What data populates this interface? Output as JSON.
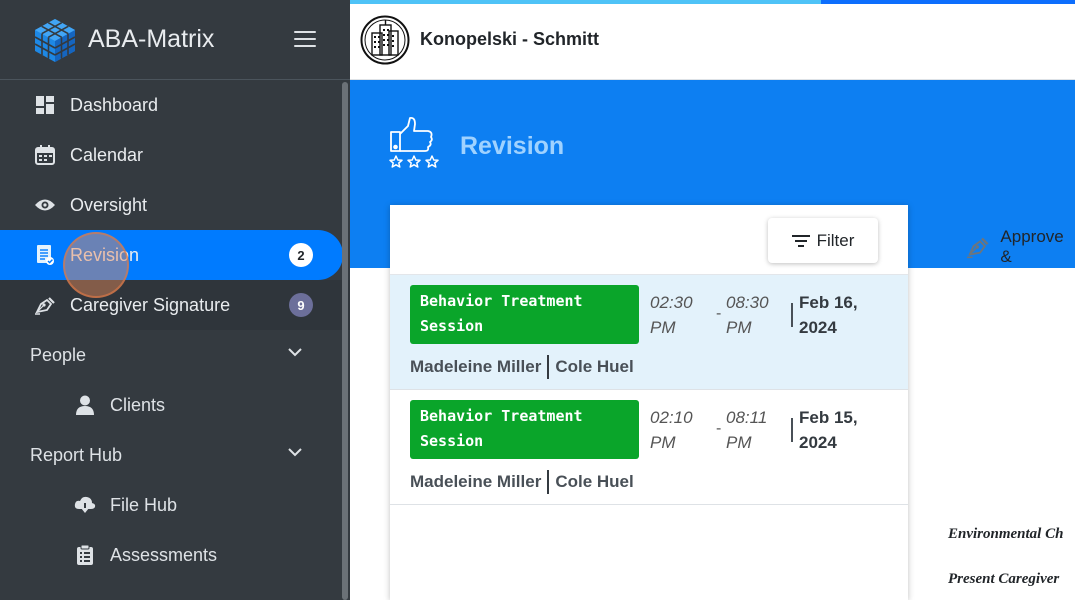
{
  "app": {
    "name": "ABA-Matrix"
  },
  "company": {
    "name": "Konopelski - Schmitt"
  },
  "nav": {
    "dashboard": "Dashboard",
    "calendar": "Calendar",
    "oversight": "Oversight",
    "revision": "Revision",
    "revision_badge": "2",
    "caregiver_signature": "Caregiver Signature",
    "caregiver_badge": "9",
    "people": "People",
    "clients": "Clients",
    "report_hub": "Report Hub",
    "file_hub": "File Hub",
    "assessments": "Assessments"
  },
  "page": {
    "title": "Revision"
  },
  "list": {
    "filter_label": "Filter",
    "sessions": [
      {
        "type": "Behavior Treatment Session",
        "start": "02:30 PM",
        "end": "08:30 PM",
        "separator": "-",
        "date": "Feb 16, 2024",
        "client": "Madeleine Miller",
        "provider": "Cole Huel"
      },
      {
        "type": "Behavior Treatment Session",
        "start": "02:10 PM",
        "end": "08:11 PM",
        "separator": "-",
        "date": "Feb 15, 2024",
        "client": "Madeleine Miller",
        "provider": "Cole Huel"
      }
    ]
  },
  "detail": {
    "approve_label": "Approve &",
    "environmental": "Environmental Ch",
    "present_caregiver": "Present Caregiver"
  },
  "progress_fraction": 0.65,
  "colors": {
    "sidebar": "#343a40",
    "accent": "#007bff",
    "hero": "#0d7ff2",
    "session_badge": "#0aa52a",
    "selected_row": "#e3f2fb"
  },
  "icons": {
    "brand": "cube-logo-icon",
    "menu": "hamburger-icon",
    "dashboard": "dashboard-grid-icon",
    "calendar": "calendar-icon",
    "oversight": "eye-icon",
    "revision": "document-check-icon",
    "signature": "pen-nib-icon",
    "clients": "user-icon",
    "file_hub": "cloud-download-icon",
    "assessments": "clipboard-icon",
    "filter": "filter-lines-icon",
    "hero": "thumbs-up-stars-icon"
  }
}
